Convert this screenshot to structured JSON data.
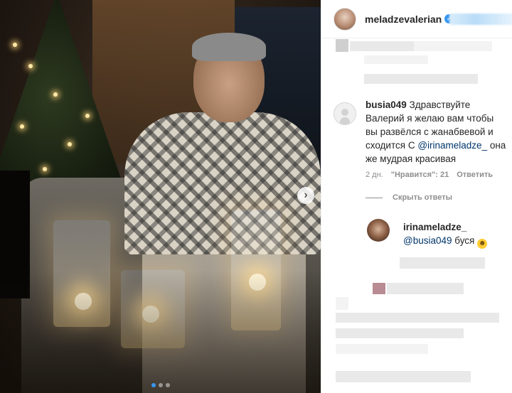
{
  "post": {
    "author": "meladzevalerian",
    "media_dots": 3,
    "active_dot": 0
  },
  "comment": {
    "user": "busia049",
    "text_before": "Здравствуйте Валерий я желаю вам чтобы вы развёлся с жанабвевой и сходится С ",
    "mention": "@irinameladze_",
    "text_after": " она же мудрая красивая",
    "time": "2 дн.",
    "likes": "\"Нравится\": 21",
    "reply_label": "Ответить",
    "hide_replies": "Скрыть ответы"
  },
  "reply": {
    "user": "irinameladze_",
    "mention": "@busia049",
    "text": " буся"
  },
  "icons": {
    "verified": "verified-badge-icon",
    "next": "chevron-right-icon",
    "emoji": "grinning-face-icon"
  },
  "colors": {
    "link": "#003569",
    "verified": "#3897f0",
    "meta": "#8e8e8e"
  }
}
